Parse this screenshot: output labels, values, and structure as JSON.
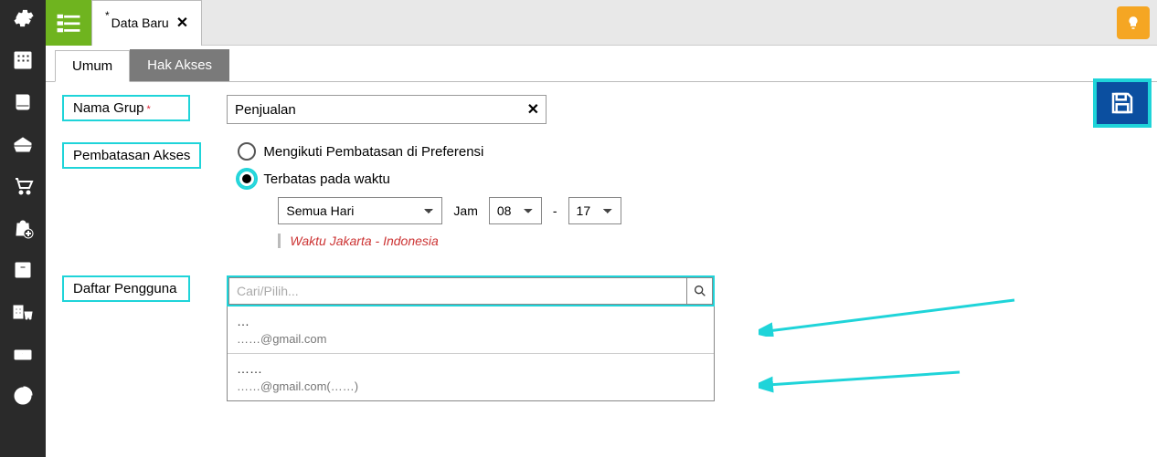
{
  "topbar": {
    "tab_dirty_marker": "*",
    "tab_label": "Data Baru",
    "tab_close": "✕"
  },
  "subtabs": {
    "umum": "Umum",
    "hak_akses": "Hak Akses"
  },
  "labels": {
    "nama_grup": "Nama Grup",
    "required_mark": "*",
    "pembatasan_akses": "Pembatasan Akses",
    "daftar_pengguna": "Daftar Pengguna"
  },
  "form": {
    "nama_grup_value": "Penjualan",
    "opt_preferensi": "Mengikuti Pembatasan di Preferensi",
    "opt_terbatas": "Terbatas pada waktu",
    "day_value": "Semua Hari",
    "jam_label": "Jam",
    "hour_from": "08",
    "dash": "-",
    "hour_to": "17",
    "tz_note": "Waktu Jakarta - Indonesia",
    "search_placeholder": "Cari/Pilih..."
  },
  "users": [
    {
      "name": "…",
      "email": "……@gmail.com"
    },
    {
      "name": "……",
      "email": "……@gmail.com(……)"
    }
  ]
}
